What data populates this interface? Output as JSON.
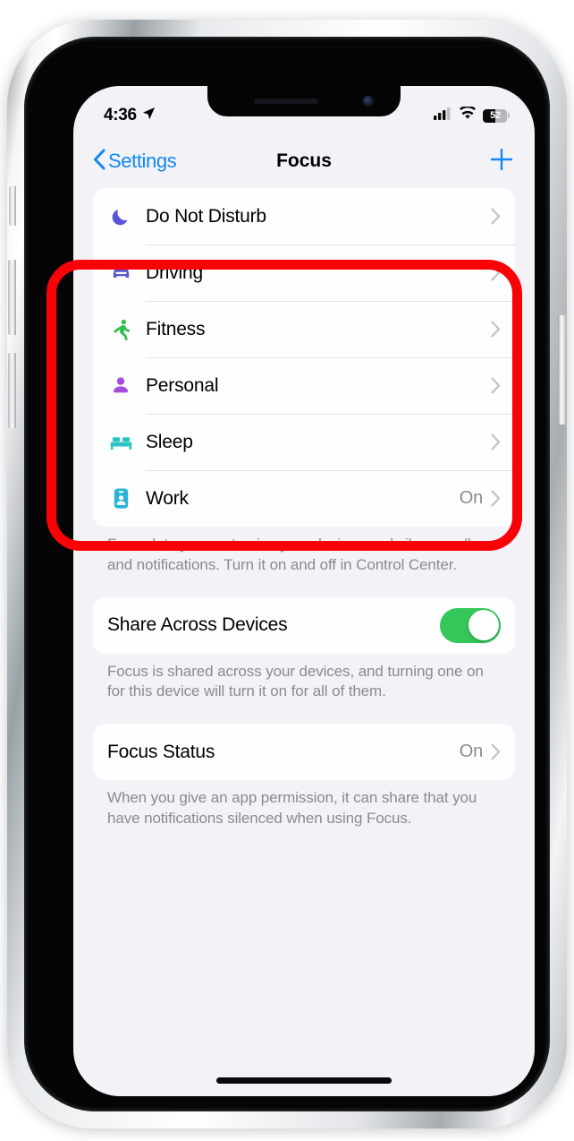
{
  "status_bar": {
    "time": "4:36",
    "location_icon": "location-arrow-icon",
    "cellular_icon": "cellular-bars-icon",
    "cellular_bars_filled": 3,
    "cellular_bars_total": 4,
    "wifi_icon": "wifi-icon",
    "battery_icon": "battery-icon",
    "battery_percent": "52",
    "battery_level": 52
  },
  "nav_bar": {
    "back_label": "Settings",
    "back_icon": "chevron-left-icon",
    "title": "Focus",
    "add_icon": "plus-icon",
    "accent_color": "#1188f6"
  },
  "focus_list": [
    {
      "label": "Do Not Disturb",
      "icon": "moon-icon",
      "icon_color": "#5856d6",
      "value": "",
      "chevron": "chevron-right-icon"
    },
    {
      "label": "Driving",
      "icon": "car-icon",
      "icon_color": "#5a58d0",
      "value": "",
      "chevron": "chevron-right-icon"
    },
    {
      "label": "Fitness",
      "icon": "running-icon",
      "icon_color": "#2fbf4a",
      "value": "",
      "chevron": "chevron-right-icon"
    },
    {
      "label": "Personal",
      "icon": "person-icon",
      "icon_color": "#a64edc",
      "value": "",
      "chevron": "chevron-right-icon"
    },
    {
      "label": "Sleep",
      "icon": "bed-icon",
      "icon_color": "#2bc4c4",
      "value": "",
      "chevron": "chevron-right-icon"
    },
    {
      "label": "Work",
      "icon": "id-badge-icon",
      "icon_color": "#2bb3d6",
      "value": "On",
      "chevron": "chevron-right-icon"
    }
  ],
  "footer_focus": "Focus lets you customize your devices and silence calls and notifications. Turn it on and off in Control Center.",
  "share_row": {
    "label": "Share Across Devices",
    "toggle_on": true,
    "toggle_on_color": "#34c759"
  },
  "footer_share": "Focus is shared across your devices, and turning one on for this device will turn it on for all of them.",
  "status_row": {
    "label": "Focus Status",
    "value": "On",
    "chevron": "chevron-right-icon"
  },
  "footer_status": "When you give an app permission, it can share that you have notifications silenced when using Focus.",
  "annotation": {
    "shape": "rounded-rectangle",
    "color": "#fb0007",
    "covers": "Driving through Work rows"
  }
}
